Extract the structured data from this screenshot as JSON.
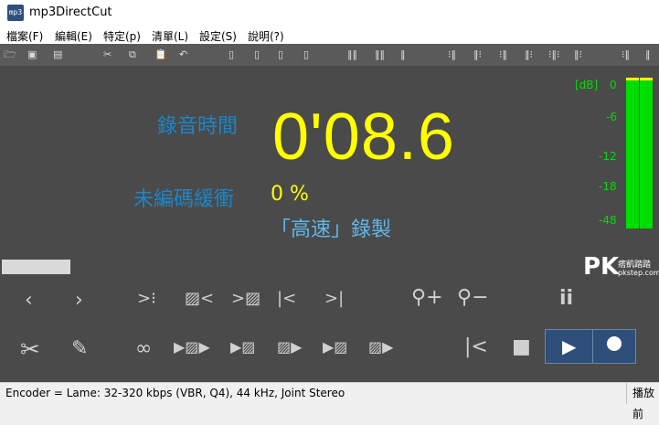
{
  "window": {
    "title": "mp3DirectCut",
    "icon_text": "mp3"
  },
  "menu": [
    "檔案(F)",
    "編輯(E)",
    "特定(p)",
    "清單(L)",
    "設定(S)",
    "說明(?)"
  ],
  "display": {
    "record_time_label": "錄音時間",
    "record_time_value": "0'08.6",
    "buffer_label": "未編碼緩衝",
    "buffer_value": "0 %",
    "record_mode": "「高速」錄製"
  },
  "meter": {
    "labels": [
      "[dB]",
      "0",
      "-6",
      "-12",
      "-18",
      "-48"
    ],
    "color": "#00dd00"
  },
  "watermark": {
    "brand": "PK",
    "sub": "痞凱踏踏",
    "site": "pkstep.com"
  },
  "status": {
    "text": "Encoder = Lame: 32-320 kbps (VBR, Q4), 44 kHz, Joint Stereo",
    "right": "播放前"
  }
}
